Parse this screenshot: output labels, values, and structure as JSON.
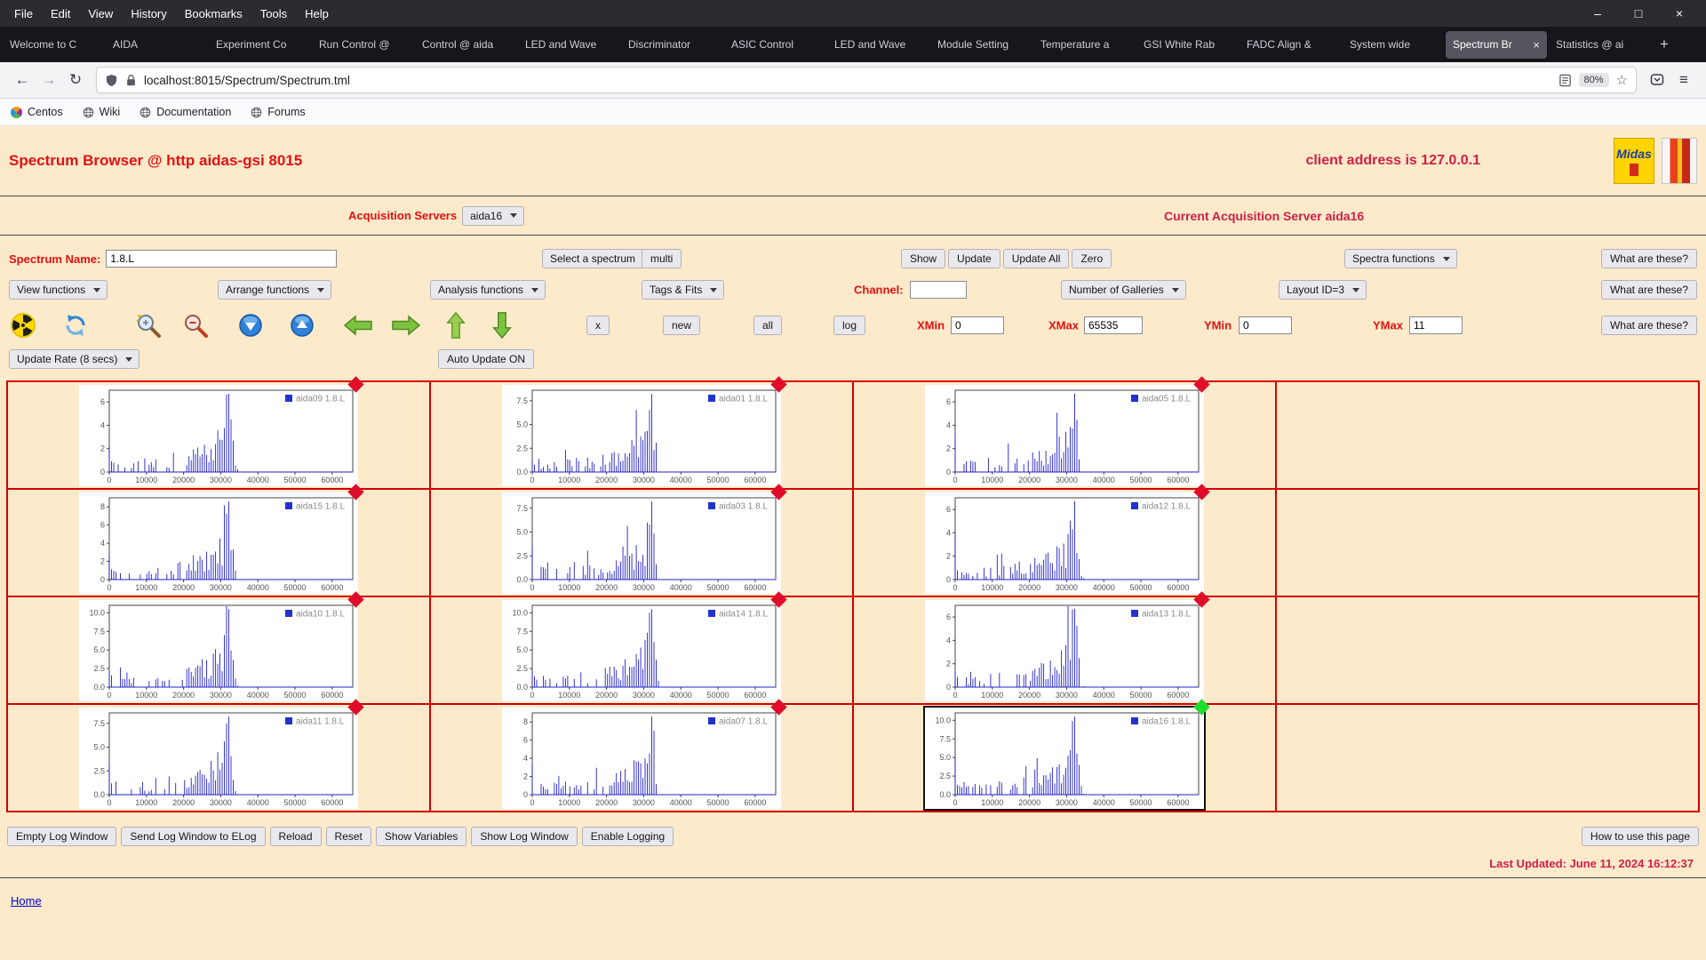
{
  "browser": {
    "menu": [
      "File",
      "Edit",
      "View",
      "History",
      "Bookmarks",
      "Tools",
      "Help"
    ],
    "tabs": [
      "Welcome to C",
      "AIDA",
      "Experiment Co",
      "Run Control @",
      "Control @ aida",
      "LED and Wave",
      "Discriminator",
      "ASIC Control",
      "LED and Wave",
      "Module Setting",
      "Temperature a",
      "GSI White Rab",
      "FADC Align &",
      "System wide",
      "Spectrum Br",
      "Statistics @ ai"
    ],
    "active_tab_index": 14,
    "url": "localhost:8015/Spectrum/Spectrum.tml",
    "zoom_level": "80%",
    "bookmarks": [
      {
        "label": "Centos",
        "icon": "centos"
      },
      {
        "label": "Wiki",
        "icon": "globe"
      },
      {
        "label": "Documentation",
        "icon": "globe"
      },
      {
        "label": "Forums",
        "icon": "globe"
      }
    ]
  },
  "icons": {
    "minimize": "–",
    "maximize": "□",
    "close": "×",
    "back": "←",
    "forward": "→",
    "reload": "↻",
    "star": "☆",
    "menu": "≡",
    "plus": "+"
  },
  "page": {
    "title": "Spectrum Browser @ http aidas-gsi 8015",
    "client_address": "client address is 127.0.0.1",
    "midas_logo_text": "Midas",
    "acquisition_servers_label": "Acquisition Servers",
    "acquisition_server_selected": "aida16",
    "current_server_text": "Current Acquisition Server aida16",
    "spectrum_name_label": "Spectrum Name:",
    "spectrum_name_value": "1.8.L",
    "select_a_spectrum": "Select a spectrum",
    "multi_button": "multi",
    "show_button": "Show",
    "update_button": "Update",
    "update_all_button": "Update All",
    "zero_button": "Zero",
    "spectra_functions": "Spectra functions",
    "what_are_these_button": "What are these?",
    "view_functions": "View functions",
    "arrange_functions": "Arrange functions",
    "analysis_functions": "Analysis functions",
    "tags_fits": "Tags & Fits",
    "channel_label": "Channel:",
    "channel_value": "",
    "number_of_galleries": "Number of Galleries",
    "layout_id": "Layout ID=3",
    "x_button": "x",
    "new_button": "new",
    "all_button": "all",
    "log_button": "log",
    "xmin_label": "XMin",
    "xmin_value": "0",
    "xmax_label": "XMax",
    "xmax_value": "65535",
    "ymin_label": "YMin",
    "ymin_value": "0",
    "ymax_label": "YMax",
    "ymax_value": "11",
    "update_rate": "Update Rate (8 secs)",
    "auto_update_button": "Auto Update ON",
    "footer_buttons": [
      "Empty Log Window",
      "Send Log Window to ELog",
      "Reload",
      "Reset",
      "Show Variables",
      "Show Log Window",
      "Enable Logging"
    ],
    "how_to_button": "How to use this page",
    "last_updated": "Last Updated: June 11, 2024 16:12:37",
    "home_link": "Home"
  },
  "chart_data": {
    "type": "histogram",
    "x_range": [
      0,
      65535
    ],
    "x_tick_labels": [
      "0",
      "10000",
      "20000",
      "30000",
      "40000",
      "50000",
      "60000"
    ],
    "line_color": "#2121c8",
    "legend_color": "#2233cc",
    "bins": 110,
    "peak_x": 32400,
    "envelope_x": [
      0,
      500,
      1500,
      3500,
      6000,
      9000,
      12500,
      16000,
      19000,
      22000,
      24500,
      26500,
      28500,
      30000,
      31200,
      31900,
      32400,
      32900,
      33600,
      34400,
      35200,
      65535
    ],
    "envelope_y": [
      0.34,
      0.14,
      0.12,
      0.11,
      0.11,
      0.12,
      0.13,
      0.14,
      0.16,
      0.2,
      0.24,
      0.28,
      0.34,
      0.42,
      0.55,
      0.8,
      1.0,
      0.5,
      0.16,
      0.04,
      0.0,
      0.0
    ],
    "charts": [
      {
        "name": "aida09 1.8.L",
        "status": "red",
        "selected": false,
        "y_tick_labels": [
          "6",
          "4",
          "2",
          "0"
        ],
        "axis_max": 7,
        "peak": 6.7,
        "seed": 11
      },
      {
        "name": "aida01 1.8.L",
        "status": "red",
        "selected": false,
        "y_tick_labels": [
          "7.5",
          "5.0",
          "2.5",
          "0.0"
        ],
        "axis_max": 8.6,
        "peak": 8.2,
        "seed": 23
      },
      {
        "name": "aida05 1.8.L",
        "status": "red",
        "selected": false,
        "y_tick_labels": [
          "6",
          "4",
          "2",
          "0"
        ],
        "axis_max": 7,
        "peak": 6.7,
        "seed": 37
      },
      {
        "name": "aida15 1.8.L",
        "status": "red",
        "selected": false,
        "y_tick_labels": [
          "8",
          "6",
          "4",
          "2",
          "0"
        ],
        "axis_max": 9,
        "peak": 8.6,
        "seed": 41
      },
      {
        "name": "aida03 1.8.L",
        "status": "red",
        "selected": false,
        "y_tick_labels": [
          "7.5",
          "5.0",
          "2.5",
          "0.0"
        ],
        "axis_max": 8.6,
        "peak": 8.2,
        "seed": 53
      },
      {
        "name": "aida12 1.8.L",
        "status": "red",
        "selected": false,
        "y_tick_labels": [
          "6",
          "4",
          "2",
          "0"
        ],
        "axis_max": 7,
        "peak": 6.7,
        "seed": 67
      },
      {
        "name": "aida10 1.8.L",
        "status": "red",
        "selected": false,
        "y_tick_labels": [
          "10.0",
          "7.5",
          "5.0",
          "2.5",
          "0.0"
        ],
        "axis_max": 11,
        "peak": 10.5,
        "seed": 71
      },
      {
        "name": "aida14 1.8.L",
        "status": "red",
        "selected": false,
        "y_tick_labels": [
          "10.0",
          "7.5",
          "5.0",
          "2.5",
          "0.0"
        ],
        "axis_max": 11,
        "peak": 10.5,
        "seed": 83
      },
      {
        "name": "aida13 1.8.L",
        "status": "red",
        "selected": false,
        "y_tick_labels": [
          "6",
          "4",
          "2",
          "0"
        ],
        "axis_max": 7,
        "peak": 6.7,
        "seed": 97
      },
      {
        "name": "aida11 1.8.L",
        "status": "red",
        "selected": false,
        "y_tick_labels": [
          "7.5",
          "5.0",
          "2.5",
          "0.0"
        ],
        "axis_max": 8.6,
        "peak": 8.2,
        "seed": 101
      },
      {
        "name": "aida07 1.8.L",
        "status": "red",
        "selected": false,
        "y_tick_labels": [
          "8",
          "6",
          "4",
          "2",
          "0"
        ],
        "axis_max": 9,
        "peak": 8.6,
        "seed": 113
      },
      {
        "name": "aida16 1.8.L",
        "status": "green",
        "selected": true,
        "y_tick_labels": [
          "10.0",
          "7.5",
          "5.0",
          "2.5",
          "0.0"
        ],
        "axis_max": 11,
        "peak": 10.5,
        "seed": 127
      }
    ]
  }
}
